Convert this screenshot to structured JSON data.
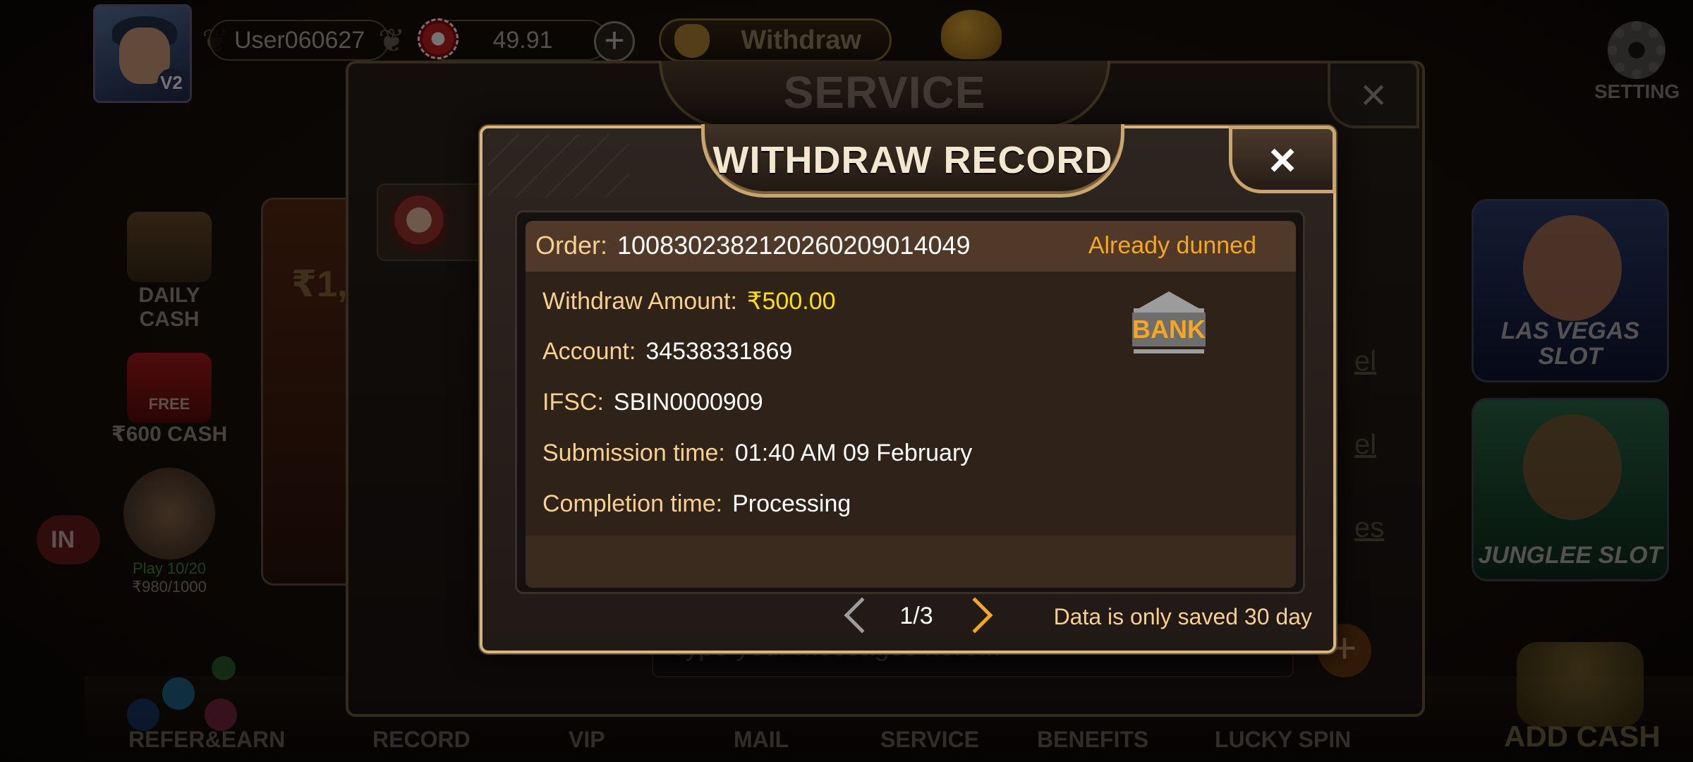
{
  "header": {
    "username": "User060627",
    "balance": "49.91",
    "withdraw_label": "Withdraw",
    "setting_label": "SETTING",
    "vip_badge": "V2"
  },
  "left_menu": {
    "daily_cash": "DAILY CASH",
    "free_badge": "FREE",
    "free_cash": "₹600 CASH",
    "play_progress": "Play 10/20",
    "reward_progress": "₹980/1000"
  },
  "promo": {
    "amount_text": "₹1,",
    "button_label": "IN"
  },
  "right_games": [
    {
      "label": "LAS VEGAS SLOT"
    },
    {
      "label": "JUNGLEE SLOT"
    }
  ],
  "bottom_nav": {
    "items": [
      "REFER&EARN",
      "RECORD",
      "VIP",
      "MAIL",
      "SERVICE",
      "BENEFITS",
      "LUCKY SPIN"
    ],
    "add_cash": "ADD CASH"
  },
  "service_dialog": {
    "title": "SERVICE",
    "close": "×",
    "input_placeholder": "Type your messages here...",
    "send": "+",
    "side_links": [
      "el",
      "el",
      "es"
    ]
  },
  "withdraw_record": {
    "title": "WITHDRAW RECORD",
    "close": "×",
    "order_label": "Order:",
    "order_number": "1008302382120260209014049",
    "status": "Already dunned",
    "withdraw_amount_label": "Withdraw Amount:",
    "withdraw_amount": "₹500.00",
    "account_label": "Account:",
    "account": "34538331869",
    "ifsc_label": "IFSC:",
    "ifsc": "SBIN0000909",
    "submission_label": "Submission time:",
    "submission_time": "01:40 AM 09 February",
    "completion_label": "Completion time:",
    "completion_time": "Processing",
    "bank_label": "BANK",
    "page_indicator": "1/3",
    "save_note": "Data is only saved 30 day"
  },
  "colors": {
    "gold_text": "#f7cf8e",
    "status_orange": "#f5a623",
    "amount_yellow": "#ffe100",
    "modal_border": "#d4b57d"
  }
}
